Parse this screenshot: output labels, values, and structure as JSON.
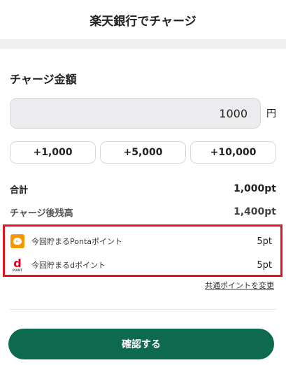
{
  "header": {
    "title": "楽天銀行でチャージ"
  },
  "charge": {
    "section_title": "チャージ金額",
    "amount_value": "1000",
    "unit": "円",
    "presets": [
      "+1,000",
      "+5,000",
      "+10,000"
    ]
  },
  "summary": {
    "total_label": "合計",
    "total_value": "1,000pt",
    "balance_label": "チャージ後残高",
    "balance_value": "1,400pt"
  },
  "points": {
    "ponta_label": "今回貯まるPontaポイント",
    "ponta_value": "5pt",
    "ponta_icon_text": "Ponta",
    "d_label": "今回貯まるdポイント",
    "d_value": "5pt",
    "d_icon_text": "d POINT"
  },
  "links": {
    "change_common_point": "共通ポイントを変更"
  },
  "footer": {
    "confirm_label": "確認する"
  },
  "colors": {
    "brand_green": "#0e6a4f",
    "highlight_red": "#e3141c",
    "ponta_orange": "#f39800",
    "d_red": "#d9001b"
  }
}
